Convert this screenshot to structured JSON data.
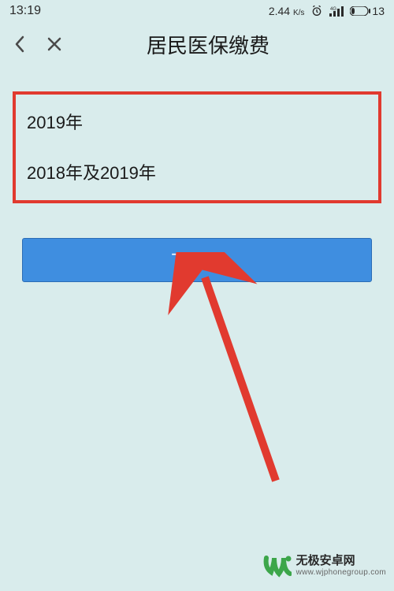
{
  "status": {
    "time": "13:19",
    "net_speed_value": "2.44",
    "net_speed_unit": "K/s",
    "battery": "13"
  },
  "header": {
    "title": "居民医保缴费"
  },
  "options": {
    "opt1": "2019年",
    "opt2": "2018年及2019年"
  },
  "next_label": "下一步",
  "watermark": {
    "name": "无极安卓网",
    "url": "www.wjphonegroup.com"
  }
}
